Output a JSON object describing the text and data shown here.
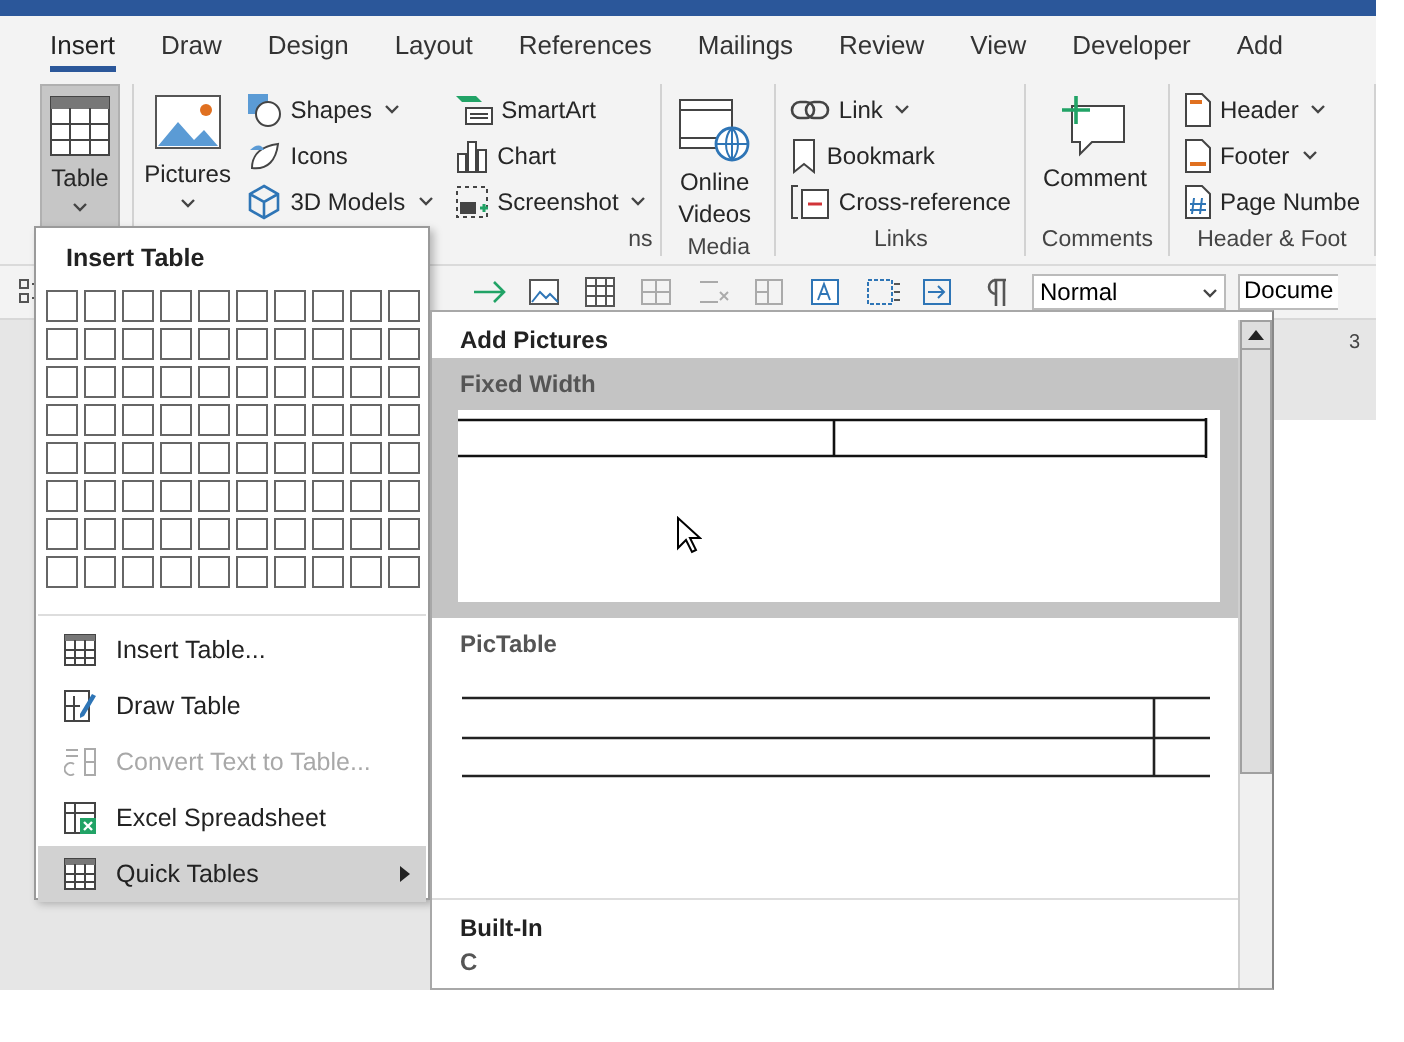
{
  "tabs": [
    {
      "label": "Insert",
      "selected": true
    },
    {
      "label": "Draw",
      "selected": false
    },
    {
      "label": "Design",
      "selected": false
    },
    {
      "label": "Layout",
      "selected": false
    },
    {
      "label": "References",
      "selected": false
    },
    {
      "label": "Mailings",
      "selected": false
    },
    {
      "label": "Review",
      "selected": false
    },
    {
      "label": "View",
      "selected": false
    },
    {
      "label": "Developer",
      "selected": false
    },
    {
      "label": "Add",
      "selected": false
    }
  ],
  "ribbon": {
    "groups": [
      {
        "kind": "tables",
        "large": [
          {
            "label": "Table",
            "pressed": true,
            "dropdown": true
          }
        ]
      },
      {
        "kind": "illustrations",
        "label": "ns",
        "large": [
          {
            "label": "Pictures",
            "pressed": false,
            "dropdown": true
          }
        ],
        "small": [
          {
            "label": "Shapes",
            "dropdown": true
          },
          {
            "label": "Icons",
            "dropdown": false
          },
          {
            "label": "3D Models",
            "dropdown": true
          },
          {
            "label": "SmartArt",
            "dropdown": false
          },
          {
            "label": "Chart",
            "dropdown": false
          },
          {
            "label": "Screenshot",
            "dropdown": true
          }
        ]
      },
      {
        "kind": "media",
        "label": "Media",
        "large": [
          {
            "label": "Online Videos",
            "pressed": false,
            "dropdown": false
          }
        ]
      },
      {
        "kind": "links",
        "label": "Links",
        "small": [
          {
            "label": "Link",
            "dropdown": true
          },
          {
            "label": "Bookmark",
            "dropdown": false
          },
          {
            "label": "Cross-reference",
            "dropdown": false
          }
        ]
      },
      {
        "kind": "comments",
        "label": "Comments",
        "large": [
          {
            "label": "Comment",
            "pressed": false,
            "dropdown": false
          }
        ]
      },
      {
        "kind": "header",
        "label": "Header & Foot",
        "small": [
          {
            "label": "Header",
            "dropdown": true
          },
          {
            "label": "Footer",
            "dropdown": true
          },
          {
            "label": "Page Numbe",
            "dropdown": false
          }
        ]
      }
    ]
  },
  "toolbar": {
    "style_box": {
      "value": "Normal"
    },
    "font_box": {
      "value": "Docume"
    }
  },
  "ruler": {
    "mark": "3"
  },
  "insert_table_menu": {
    "title": "Insert Table",
    "items": [
      {
        "label": "Insert Table...",
        "disabled": false,
        "selected": false,
        "submenu": false
      },
      {
        "label": "Draw Table",
        "disabled": false,
        "selected": false,
        "submenu": false
      },
      {
        "label": "Convert Text to Table...",
        "disabled": true,
        "selected": false,
        "submenu": false
      },
      {
        "label": "Excel Spreadsheet",
        "disabled": false,
        "selected": false,
        "submenu": false
      },
      {
        "label": "Quick Tables",
        "disabled": false,
        "selected": true,
        "submenu": true
      }
    ]
  },
  "quick_tables_gallery": {
    "categories": [
      {
        "heading": "Add Pictures",
        "entries": [
          {
            "title": "Fixed Width",
            "kind": "fixed-width",
            "selected": true
          },
          {
            "title": "PicTable",
            "kind": "pictable",
            "selected": false
          }
        ]
      },
      {
        "heading": "Built-In",
        "entries": [
          {
            "title": "C",
            "kind": "cut",
            "selected": false
          }
        ]
      }
    ]
  }
}
